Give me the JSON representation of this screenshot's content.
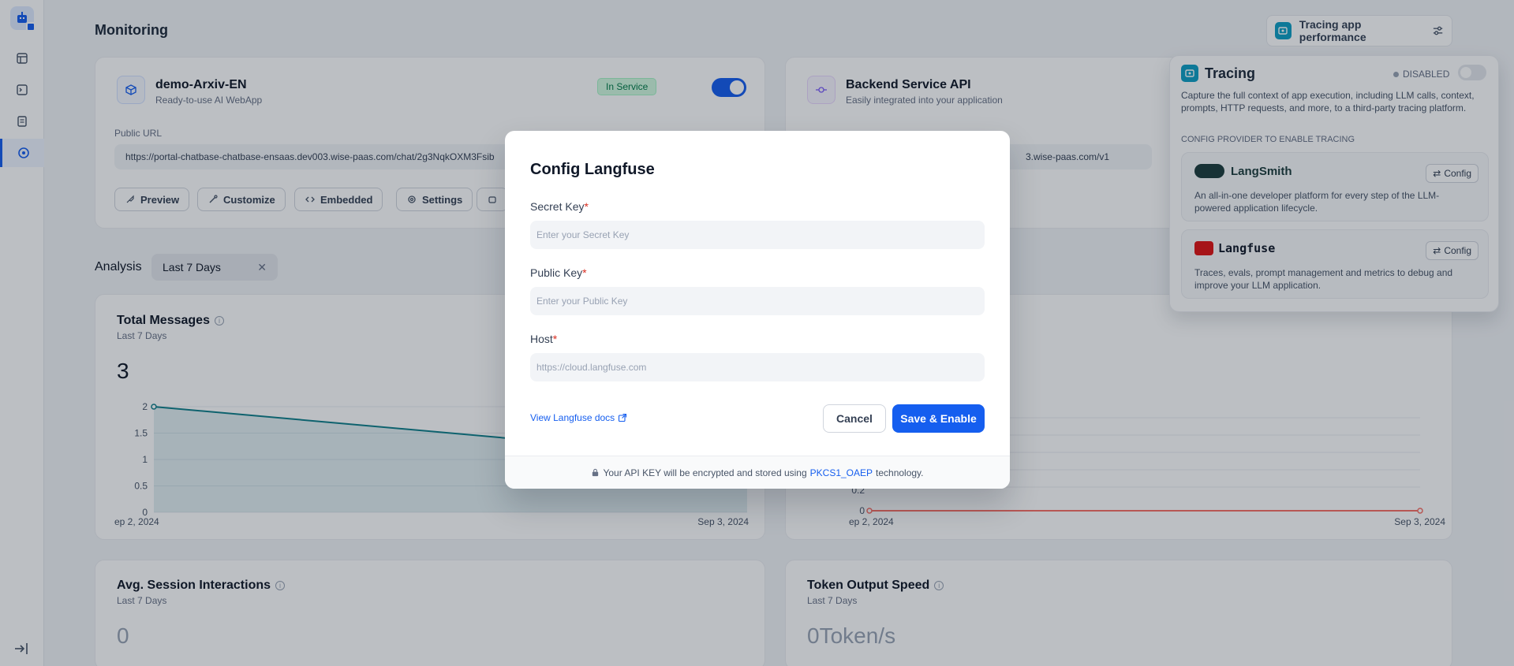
{
  "page": {
    "title": "Monitoring"
  },
  "tracing_button": {
    "label": "Tracing app performance"
  },
  "webapp_card": {
    "title": "demo-Arxiv-EN",
    "subtitle": "Ready-to-use AI WebApp",
    "status": "In Service",
    "enabled": true,
    "url_label": "Public URL",
    "url": "https://portal-chatbase-chatbase-ensaas.dev003.wise-paas.com/chat/2g3NqkOXM3Fsib",
    "buttons": [
      "Preview",
      "Customize",
      "Embedded",
      "Settings"
    ]
  },
  "api_card": {
    "title": "Backend Service API",
    "subtitle": "Easily integrated into your application",
    "endpoint_tail": "3.wise-paas.com/v1"
  },
  "analysis": {
    "label": "Analysis",
    "period": "Last 7 Days"
  },
  "stats": {
    "total_messages": {
      "title": "Total Messages",
      "sub": "Last 7 Days",
      "value": "3"
    },
    "avg_session": {
      "title": "Avg. Session Interactions",
      "sub": "Last 7 Days",
      "value": "0"
    },
    "token_speed": {
      "title": "Token Output Speed",
      "sub": "Last 7 Days",
      "value": "0Token/s"
    }
  },
  "chart_data": [
    {
      "type": "area",
      "x": [
        "Sep 2, 2024",
        "Sep 3, 2024"
      ],
      "x_tick_labels": [
        "ep 2, 2024",
        "Sep 3, 2024"
      ],
      "values": [
        2,
        1
      ],
      "y_ticks": [
        "2",
        "1.5",
        "1",
        "0.5",
        "0"
      ],
      "ylim": [
        0,
        2
      ],
      "color": "#0e7f8a"
    },
    {
      "type": "line",
      "x": [
        "Sep 2, 2024",
        "Sep 3, 2024"
      ],
      "x_tick_labels": [
        "ep 2, 2024",
        "Sep 3, 2024"
      ],
      "values": [
        0,
        0
      ],
      "y_ticks": [
        "0.2",
        "0"
      ],
      "color": "#f97066"
    }
  ],
  "tracing_panel": {
    "title": "Tracing",
    "status": "DISABLED",
    "description": "Capture the full context of app execution, including LLM calls, context, prompts, HTTP requests, and more, to a third-party tracing platform.",
    "section": "CONFIG PROVIDER TO ENABLE TRACING",
    "providers": [
      {
        "name": "LangSmith",
        "desc": "An all-in-one developer platform for every step of the LLM-powered application lifecycle.",
        "config": "Config"
      },
      {
        "name": "Langfuse",
        "desc": "Traces, evals, prompt management and metrics to debug and improve your LLM application.",
        "config": "Config"
      }
    ]
  },
  "modal": {
    "title": "Config Langfuse",
    "secret_key": {
      "label": "Secret Key",
      "placeholder": "Enter your Secret Key"
    },
    "public_key": {
      "label": "Public Key",
      "placeholder": "Enter your Public Key"
    },
    "host": {
      "label": "Host",
      "placeholder": "https://cloud.langfuse.com"
    },
    "docs_link": "View Langfuse docs",
    "cancel": "Cancel",
    "save": "Save & Enable",
    "footer_prefix": "Your API KEY will be encrypted and stored using",
    "footer_tech": "PKCS1_OAEP",
    "footer_suffix": "technology."
  },
  "colors": {
    "primary": "#155eef",
    "area": "#0e7f8a",
    "line2": "#f97066"
  }
}
